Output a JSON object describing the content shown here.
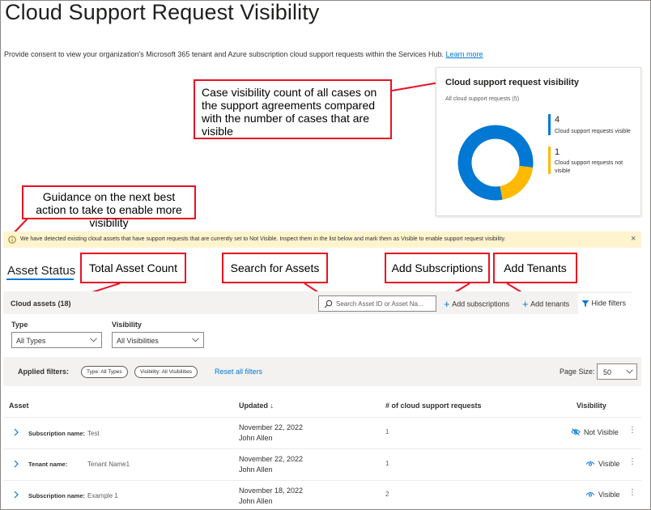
{
  "page": {
    "title": "Cloud Support Request Visibility",
    "intro": "Provide consent to view your organization's Microsoft 365 tenant and Azure subscription cloud support requests within the Services Hub.",
    "learn_more": "Learn more"
  },
  "callouts": {
    "case_count": "Case visibility count of all cases on the support agreements compared with the number of cases that are visible",
    "guidance": "Guidance on the next best action to take to enable more visibility",
    "total_asset": "Total Asset Count",
    "search_assets": "Search for Assets",
    "add_subscriptions": "Add Subscriptions",
    "add_tenants": "Add Tenants"
  },
  "card": {
    "title": "Cloud support request visibility",
    "subtitle": "All cloud support requests (5)",
    "legend": [
      {
        "count": "4",
        "label": "Cloud support requests visible",
        "color": "#0078d4"
      },
      {
        "count": "1",
        "label": "Cloud support requests not visible",
        "color": "#ffb900"
      }
    ]
  },
  "chart_data": {
    "type": "pie",
    "title": "Cloud support request visibility",
    "subtitle": "All cloud support requests (5)",
    "categories": [
      "Cloud support requests visible",
      "Cloud support requests not visible"
    ],
    "values": [
      4,
      1
    ],
    "colors": [
      "#0078d4",
      "#ffb900"
    ],
    "donut": true
  },
  "banner": {
    "text": "We have detected existing cloud assets that have support requests that are currently set to Not Visible. Inspect them in the list below and mark them as Visible to enable support request visibility.",
    "close": "×"
  },
  "section": {
    "title": "Asset Status"
  },
  "toolbar": {
    "count": "Cloud assets (18)",
    "search_placeholder": "Search Asset ID or Asset Na...",
    "add_subscriptions": "Add subscriptions",
    "add_tenants": "Add tenants",
    "hide_filters": "Hide filters"
  },
  "filters": {
    "type_label": "Type",
    "type_value": "All Types",
    "visibility_label": "Visibility",
    "visibility_value": "All Visibilities"
  },
  "applied": {
    "label": "Applied filters:",
    "pill_type": "Type: All Types",
    "pill_visibility": "Visibility: All Visibilities",
    "reset": "Reset all filters",
    "page_size_label": "Page Size:",
    "page_size_value": "50"
  },
  "table": {
    "headers": {
      "asset": "Asset",
      "updated": "Updated ↓",
      "requests": "# of cloud support requests",
      "visibility": "Visibility"
    },
    "rows": [
      {
        "label": "Subscription name:",
        "name": "Test",
        "date": "November 22, 2022",
        "user": "John Allen",
        "count": "1",
        "visibility": "Not Visible"
      },
      {
        "label": "Tenant name:",
        "name": "Tenant Name1",
        "date": "November 22, 2022",
        "user": "John Allen",
        "count": "1",
        "visibility": "Visible"
      },
      {
        "label": "Subscription name:",
        "name": "Example 1",
        "date": "November 18, 2022",
        "user": "John Allen",
        "count": "2",
        "visibility": "Visible"
      }
    ]
  }
}
